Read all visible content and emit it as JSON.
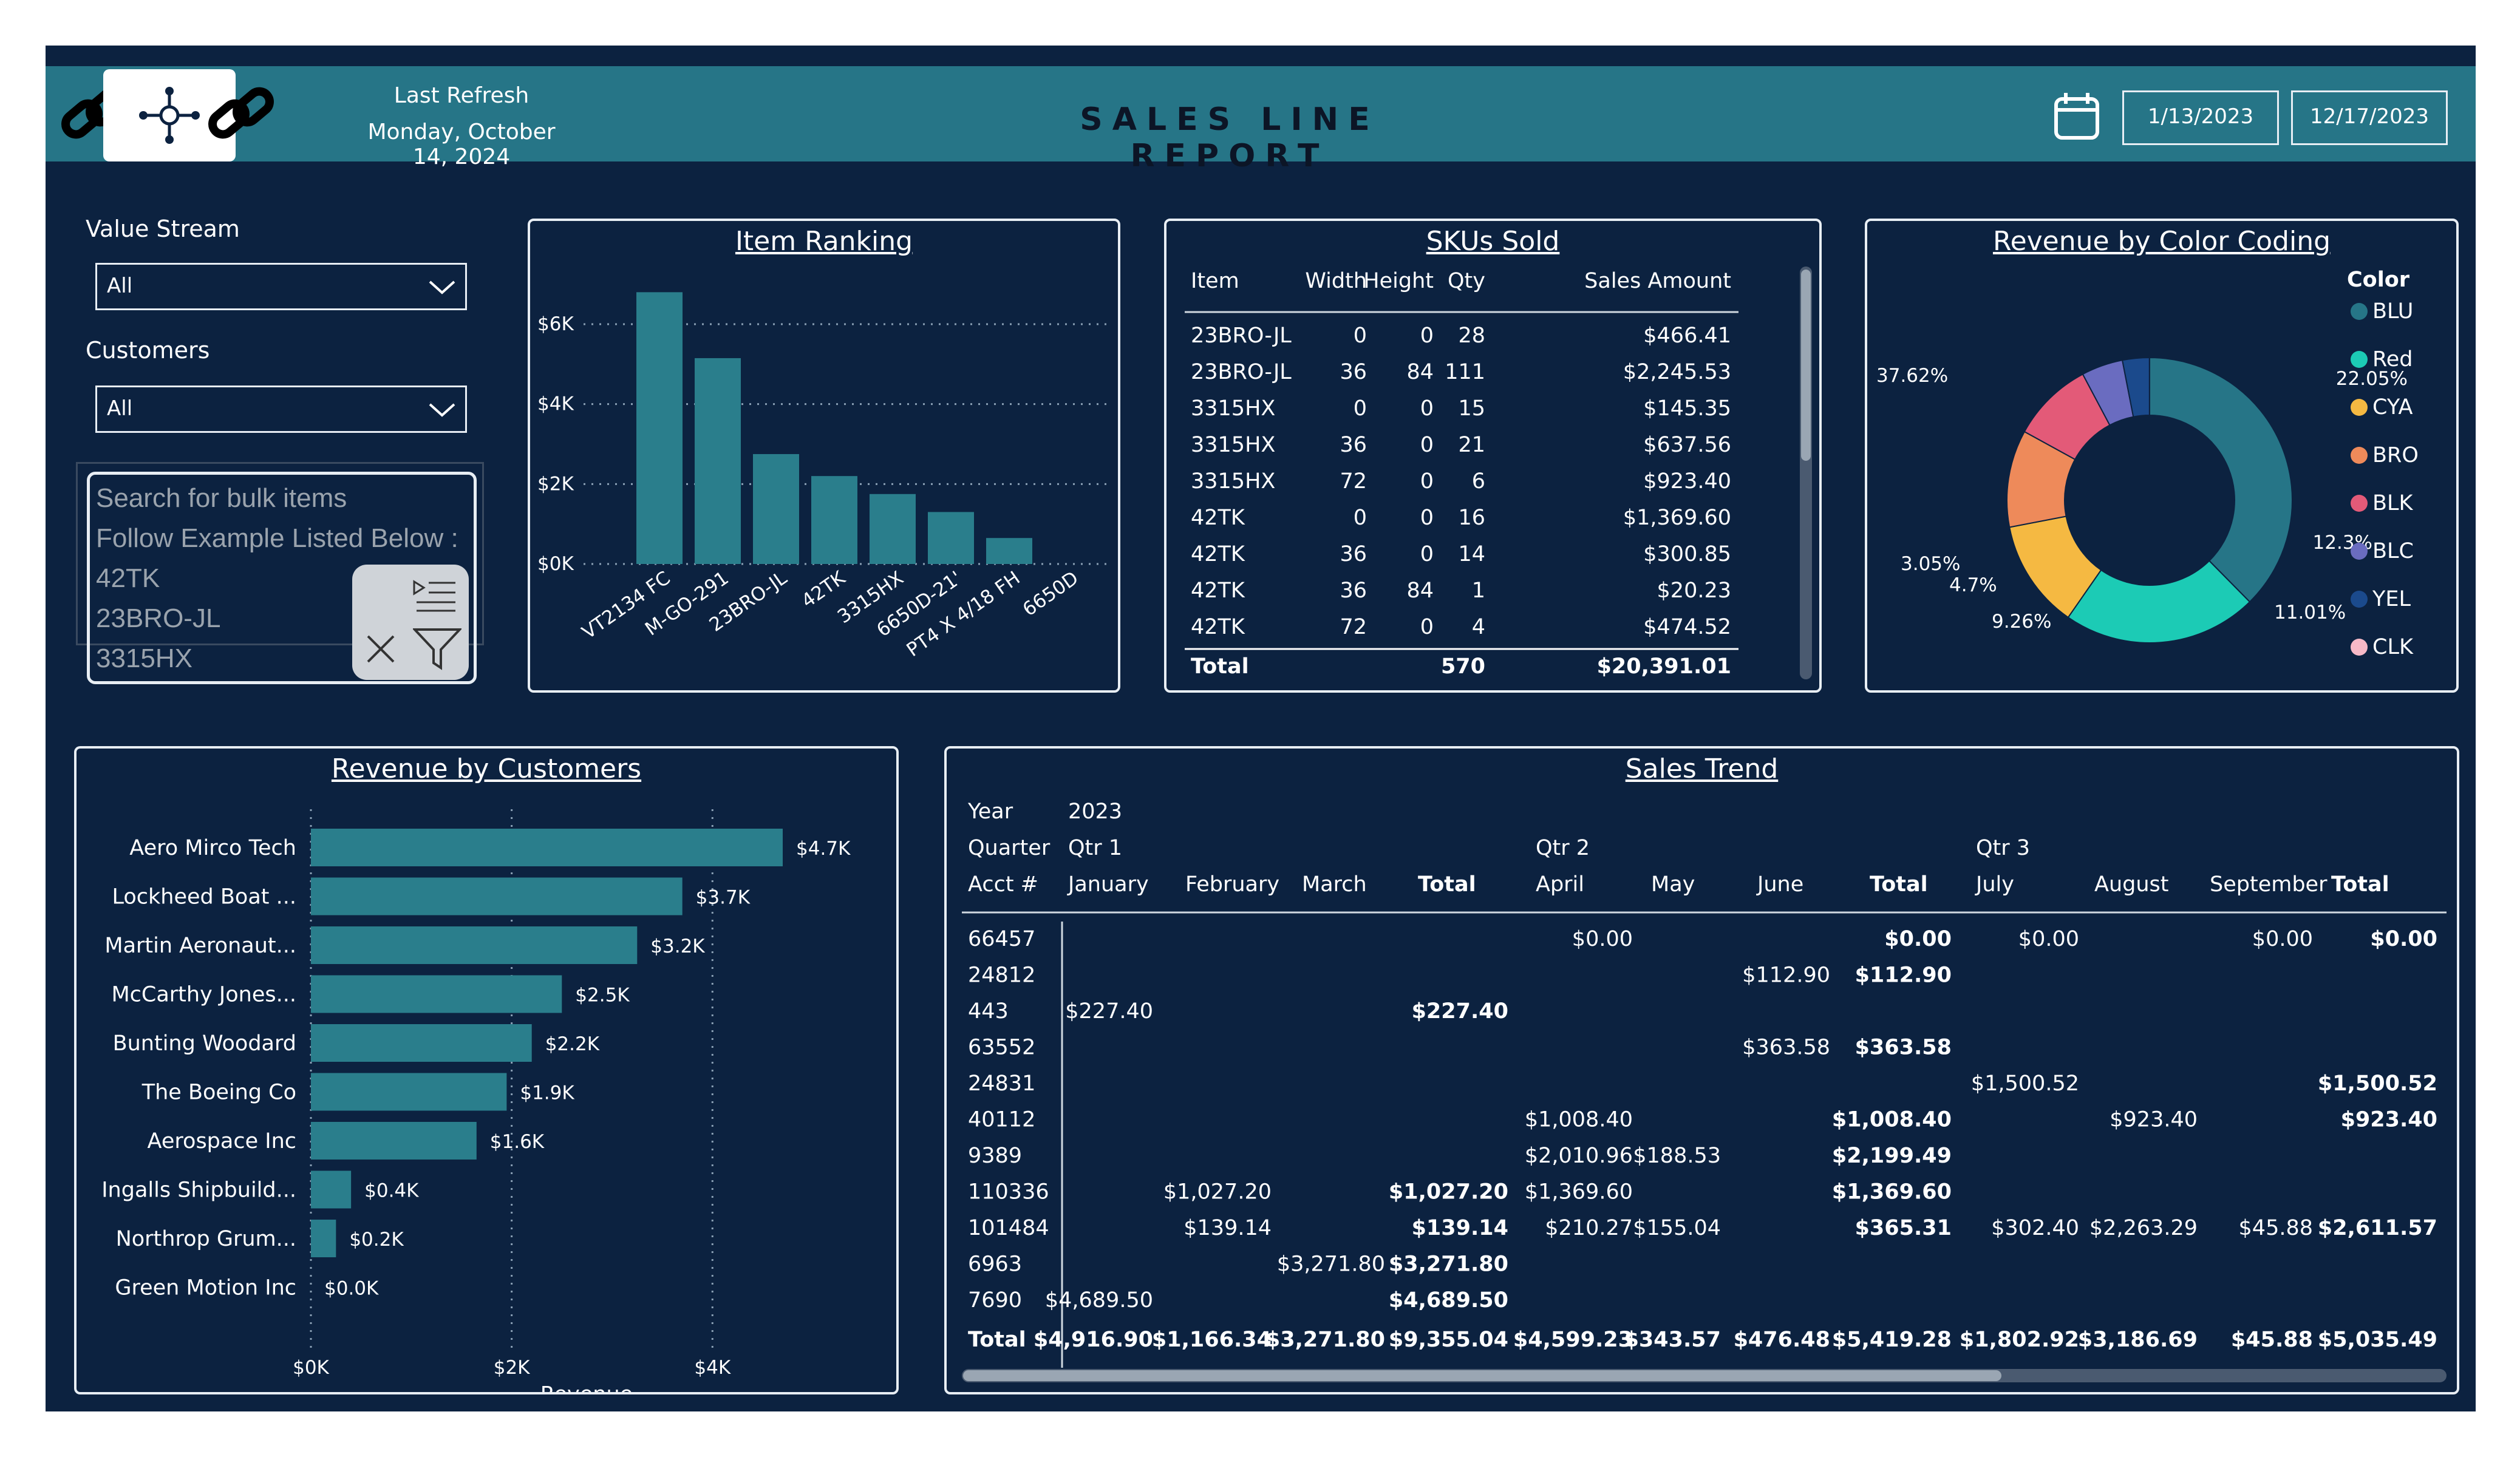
{
  "header": {
    "last_refresh_label": "Last Refresh",
    "last_refresh_date": "Monday, October 14, 2024",
    "title": "SALES LINE REPORT",
    "date_start": "1/13/2023",
    "date_end": "12/17/2023"
  },
  "filters": {
    "value_stream_label": "Value Stream",
    "value_stream_value": "All",
    "customers_label": "Customers",
    "customers_value": "All",
    "search_lines": [
      "Search for bulk items",
      "Follow Example Listed Below :",
      "42TK",
      "23BRO-JL",
      "3315HX"
    ]
  },
  "colors": {
    "background": "#0c2240",
    "header": "#267587",
    "bar": "#2a7e8c",
    "donut": [
      "#267587",
      "#1ccbb5",
      "#f5b942",
      "#ee8a5a",
      "#e35a78",
      "#6a6cc0",
      "#1b4a8c",
      "#f7b9c7"
    ]
  },
  "item_ranking": {
    "title": "Item Ranking",
    "chart_data": {
      "type": "bar",
      "categories": [
        "VT2134 FC",
        "M-GO-291",
        "23BRO-JL",
        "42TK",
        "3315HX",
        "6650D-21'",
        "PT4 X 4/18 FH",
        "6650D"
      ],
      "values": [
        6.8,
        5.15,
        2.75,
        2.2,
        1.75,
        1.3,
        0.65,
        0
      ],
      "ytick_labels": [
        "$0K",
        "$2K",
        "$4K",
        "$6K"
      ],
      "ylim": [
        0,
        6
      ]
    }
  },
  "skus": {
    "title": "SKUs Sold",
    "columns": [
      "Item",
      "Width",
      "Height",
      "Qty",
      "Sales Amount"
    ],
    "rows": [
      [
        "23BRO-JL",
        "0",
        "0",
        "28",
        "$466.41"
      ],
      [
        "23BRO-JL",
        "36",
        "84",
        "111",
        "$2,245.53"
      ],
      [
        "3315HX",
        "0",
        "0",
        "15",
        "$145.35"
      ],
      [
        "3315HX",
        "36",
        "0",
        "21",
        "$637.56"
      ],
      [
        "3315HX",
        "72",
        "0",
        "6",
        "$923.40"
      ],
      [
        "42TK",
        "0",
        "0",
        "16",
        "$1,369.60"
      ],
      [
        "42TK",
        "36",
        "0",
        "14",
        "$300.85"
      ],
      [
        "42TK",
        "36",
        "84",
        "1",
        "$20.23"
      ],
      [
        "42TK",
        "72",
        "0",
        "4",
        "$474.52"
      ]
    ],
    "total": [
      "Total",
      "",
      "",
      "570",
      "$20,391.01"
    ]
  },
  "color_coding": {
    "title": "Revenue by Color Coding",
    "legend_title": "Color",
    "chart_data": {
      "type": "pie",
      "labels": [
        "BLU",
        "Red",
        "CYA",
        "BRO",
        "BLK",
        "BLC",
        "YEL",
        "CLK"
      ],
      "values": [
        37.62,
        22.05,
        12.3,
        11.01,
        9.26,
        4.7,
        3.05,
        0.01
      ],
      "data_labels": [
        "37.62%",
        "22.05%",
        "12.3%",
        "11.01%",
        "9.26%",
        "4.7%",
        "3.05%",
        ""
      ]
    }
  },
  "customers": {
    "title": "Revenue by Customers",
    "chart_data": {
      "type": "bar",
      "categories": [
        "Aero Mirco Tech",
        "Lockheed Boat ...",
        "Martin Aeronaut...",
        "McCarthy Jones...",
        "Bunting Woodard",
        "The Boeing Co",
        "Aerospace Inc",
        "Ingalls Shipbuild...",
        "Northrop Grum...",
        "Green Motion Inc"
      ],
      "values": [
        4.7,
        3.7,
        3.25,
        2.5,
        2.2,
        1.95,
        1.65,
        0.4,
        0.25,
        0
      ],
      "data_labels": [
        "$4.7K",
        "$3.7K",
        "$3.2K",
        "$2.5K",
        "$2.2K",
        "$1.9K",
        "$1.6K",
        "$0.4K",
        "$0.2K",
        "$0.0K"
      ],
      "xtick_labels": [
        "$0K",
        "$2K",
        "$4K"
      ],
      "xlabel": "Revenue",
      "xlim": [
        0,
        4.7
      ]
    }
  },
  "sales_trend": {
    "title": "Sales Trend",
    "year_label": "Year",
    "year": "2023",
    "quarter_label": "Quarter",
    "qtr1": "Qtr 1",
    "qtr2": "Qtr 2",
    "qtr3": "Qtr 3",
    "acct_label": "Acct #",
    "columns": [
      "January",
      "February",
      "March",
      "Total",
      "April",
      "May",
      "June",
      "Total",
      "July",
      "August",
      "September",
      "Total"
    ],
    "rows": [
      [
        "66457",
        "",
        "",
        "",
        "",
        "$0.00",
        "",
        "",
        "$0.00",
        "$0.00",
        "",
        "$0.00",
        "$0.00"
      ],
      [
        "24812",
        "",
        "",
        "",
        "",
        "",
        "",
        "$112.90",
        "$112.90",
        "",
        "",
        "",
        ""
      ],
      [
        "443",
        "$227.40",
        "",
        "",
        "$227.40",
        "",
        "",
        "",
        "",
        "",
        "",
        "",
        ""
      ],
      [
        "63552",
        "",
        "",
        "",
        "",
        "",
        "",
        "$363.58",
        "$363.58",
        "",
        "",
        "",
        ""
      ],
      [
        "24831",
        "",
        "",
        "",
        "",
        "",
        "",
        "",
        "",
        "$1,500.52",
        "",
        "",
        "$1,500.52"
      ],
      [
        "40112",
        "",
        "",
        "",
        "",
        "$1,008.40",
        "",
        "",
        "$1,008.40",
        "",
        "$923.40",
        "",
        "$923.40"
      ],
      [
        "9389",
        "",
        "",
        "",
        "",
        "$2,010.96",
        "$188.53",
        "",
        "$2,199.49",
        "",
        "",
        "",
        ""
      ],
      [
        "110336",
        "",
        "$1,027.20",
        "",
        "$1,027.20",
        "$1,369.60",
        "",
        "",
        "$1,369.60",
        "",
        "",
        "",
        ""
      ],
      [
        "101484",
        "",
        "$139.14",
        "",
        "$139.14",
        "$210.27",
        "$155.04",
        "",
        "$365.31",
        "$302.40",
        "$2,263.29",
        "$45.88",
        "$2,611.57"
      ],
      [
        "6963",
        "",
        "",
        "$3,271.80",
        "$3,271.80",
        "",
        "",
        "",
        "",
        "",
        "",
        "",
        ""
      ],
      [
        "7690",
        "$4,689.50",
        "",
        "",
        "$4,689.50",
        "",
        "",
        "",
        "",
        "",
        "",
        "",
        ""
      ]
    ],
    "total": [
      "Total",
      "$4,916.90",
      "$1,166.34",
      "$3,271.80",
      "$9,355.04",
      "$4,599.23",
      "$343.57",
      "$476.48",
      "$5,419.28",
      "$1,802.92",
      "$3,186.69",
      "$45.88",
      "$5,035.49"
    ]
  }
}
